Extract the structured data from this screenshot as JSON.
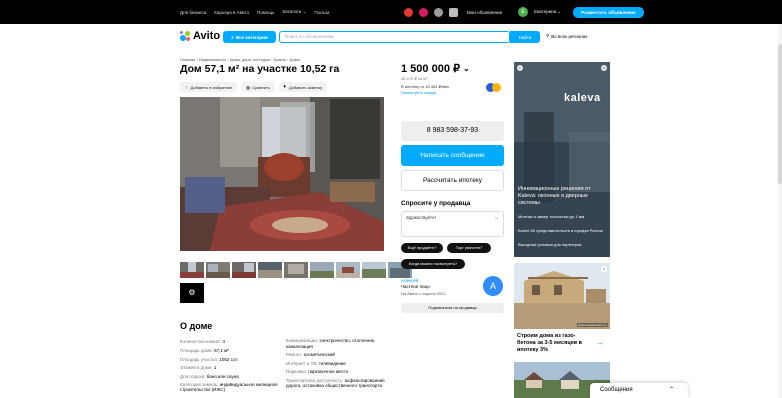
{
  "topbar": {
    "links": [
      "Для бизнеса",
      "Карьера в Авито",
      "Помощь",
      "Каталоги",
      "Польза"
    ],
    "my_ads": "Мои объявления",
    "user_initial": "Е",
    "user_name": "Екатерина",
    "post_button": "Разместить объявление"
  },
  "header": {
    "logo": "Avito",
    "categories_button": "Все категории",
    "search_placeholder": "Поиск по объявлениям",
    "find_button": "Найти",
    "region": "Во всех регионах"
  },
  "listing": {
    "breadcrumb": "Главная › Недвижимость › Дома, дачи, коттеджи › Купить › Дома",
    "title": "Дом 57,1 м² на участке 10,52 га",
    "actions": {
      "favorite": "Добавить в избранное",
      "compare": "Сравнить",
      "note": "Добавить заметку"
    },
    "price": "1 500 000 ₽",
    "price_per_m2": "26 270 ₽ за м²",
    "mortgage_text": "В ипотеку от 15 481 ₽/мес",
    "mortgage_link": "Посмотреть скидки",
    "phone_button": "8 983 598-37-93",
    "message_button": "Написать сообщение",
    "calc_button": "Рассчитать ипотеку",
    "ask_title": "Спросите у продавца",
    "ask_placeholder": "Здравствуйте!",
    "chips": [
      "Ещё продаёте?",
      "Торг уместен?",
      "Когда можно посмотреть?"
    ],
    "seller": {
      "name": "Алексей",
      "type": "Частное лицо",
      "since": "На Авито с апреля 2022",
      "initial": "А",
      "subscribe": "Подписаться на продавца"
    }
  },
  "about": {
    "title": "О доме",
    "left": [
      {
        "k": "Количество комнат: ",
        "v": "3"
      },
      {
        "k": "Площадь дома: ",
        "v": "57,1 м²"
      },
      {
        "k": "Площадь участка: ",
        "v": "1052 сот."
      },
      {
        "k": "Этажей в доме: ",
        "v": "1"
      },
      {
        "k": "Для отдыха: ",
        "v": "баня или сауна"
      },
      {
        "k": "Категория земель: ",
        "v": "индивидуальное жилищное строительство (ИЖС)"
      }
    ],
    "right": [
      {
        "k": "Коммуникации: ",
        "v": "электричество, отопление, канализация"
      },
      {
        "k": "Ремонт: ",
        "v": "косметический"
      },
      {
        "k": "Интернет и ТВ: ",
        "v": "телевидение"
      },
      {
        "k": "Парковка: ",
        "v": "парковочное место"
      },
      {
        "k": "Транспортная доступность: ",
        "v": "асфальтированная дорога, остановка общественного транспорта"
      }
    ]
  },
  "ads": {
    "ad1_brand": "kaleva",
    "ad1_headline": "Инновационные решения от Kaleva: оконные и дверные системы",
    "ad1_points": [
      "Монтаж и замер точностью до 1 мм",
      "Более 60 представительств в городах России",
      "Выгодные условия для партнеров"
    ],
    "ad2_watermark": "www.mospromdom.ru",
    "ad2_caption": "Строим дома из газо-бетона за 3-5 месяцев в ипотеку 3%"
  },
  "messages_bar": "Сообщения",
  "colors": {
    "accent": "#00aaff",
    "topbar": "#000000",
    "badge": "#4caf50"
  }
}
